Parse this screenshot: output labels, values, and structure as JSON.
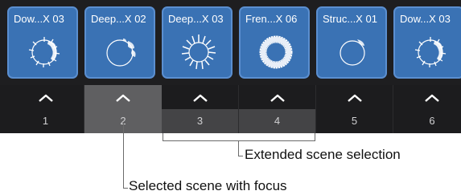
{
  "scenes": [
    {
      "label": "Dow...X 03",
      "number": "1",
      "icon": "waveform-ring-icon"
    },
    {
      "label": "Deep...X 02",
      "number": "2",
      "icon": "sparse-ring-icon"
    },
    {
      "label": "Deep...X 03",
      "number": "3",
      "icon": "spiky-ring-icon"
    },
    {
      "label": "Fren...X 06",
      "number": "4",
      "icon": "dense-ring-icon"
    },
    {
      "label": "Struc...X 01",
      "number": "5",
      "icon": "thin-ring-icon"
    },
    {
      "label": "Dow...X 03",
      "number": "6",
      "icon": "waveform-ring-icon"
    }
  ],
  "callouts": {
    "extended": "Extended scene selection",
    "selected": "Selected scene with focus"
  },
  "colors": {
    "tile_blue": "#3a72b4",
    "tile_border": "#5b8fd0",
    "strip_bg": "#1c1c1e",
    "selected_bg": "#5f5f61",
    "extended_bg": "#444446"
  }
}
